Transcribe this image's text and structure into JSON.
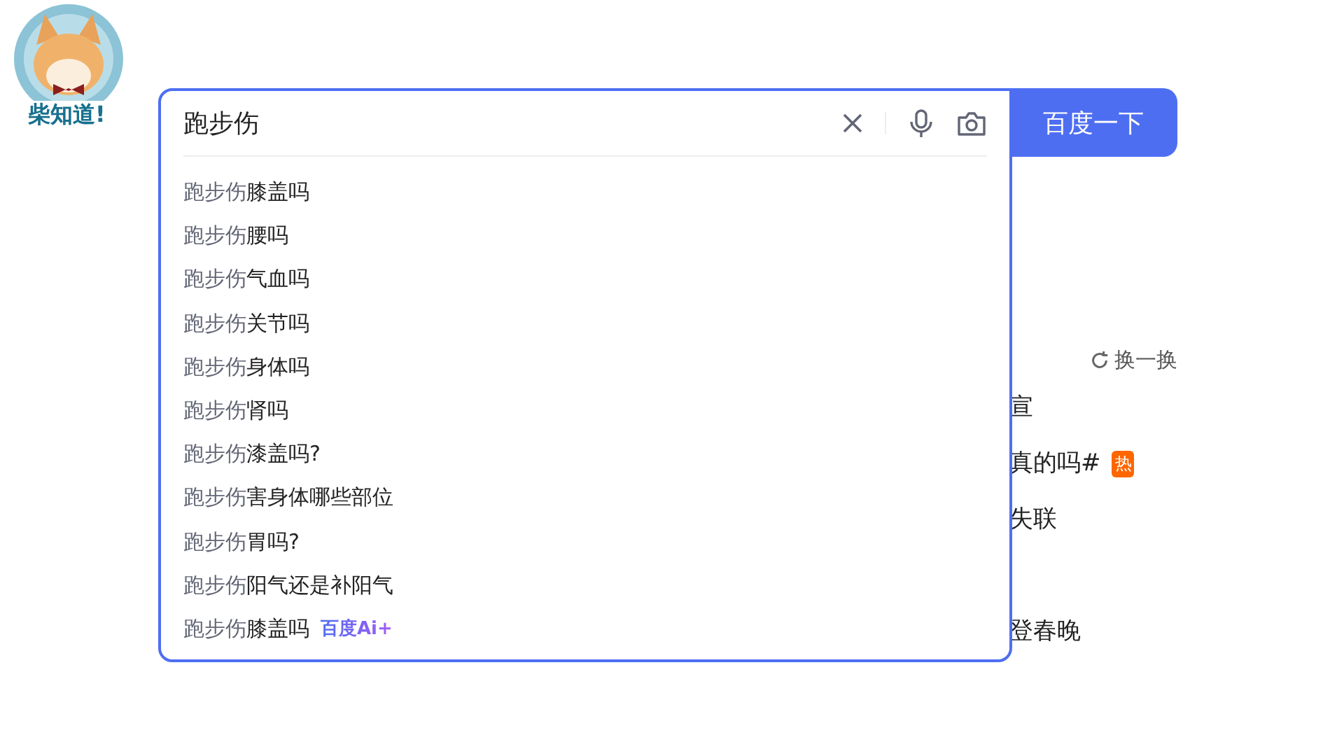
{
  "logo": {
    "text": "柴知道!"
  },
  "search": {
    "value": "跑步伤",
    "button": "百度一下"
  },
  "suggestions": [
    {
      "kind": "plain",
      "query": "跑步伤",
      "completion": "膝盖吗"
    },
    {
      "kind": "plain",
      "query": "跑步伤",
      "completion": "腰吗"
    },
    {
      "kind": "plain",
      "query": "跑步伤",
      "completion": "气血吗"
    },
    {
      "kind": "plain",
      "query": "跑步伤",
      "completion": "关节吗"
    },
    {
      "kind": "plain",
      "query": "跑步伤",
      "completion": "身体吗"
    },
    {
      "kind": "plain",
      "query": "跑步伤",
      "completion": "肾吗"
    },
    {
      "kind": "plain",
      "query": "跑步伤",
      "completion": "漆盖吗?"
    },
    {
      "kind": "plain",
      "query": "跑步伤",
      "completion": "害身体哪些部位"
    },
    {
      "kind": "plain",
      "query": "跑步伤",
      "completion": "胃吗?"
    },
    {
      "kind": "plain",
      "query": "跑步伤",
      "completion": "阳气还是补阳气"
    },
    {
      "kind": "ai",
      "query": "跑步伤",
      "completion": "膝盖吗",
      "badge": "百度Ai+"
    }
  ],
  "hot_list": {
    "refresh": "换一换",
    "items": [
      {
        "text": "宣"
      },
      {
        "text": "真的吗#",
        "badge": "热"
      },
      {
        "text": "失联"
      },
      {
        "text": "登春晚"
      }
    ]
  }
}
